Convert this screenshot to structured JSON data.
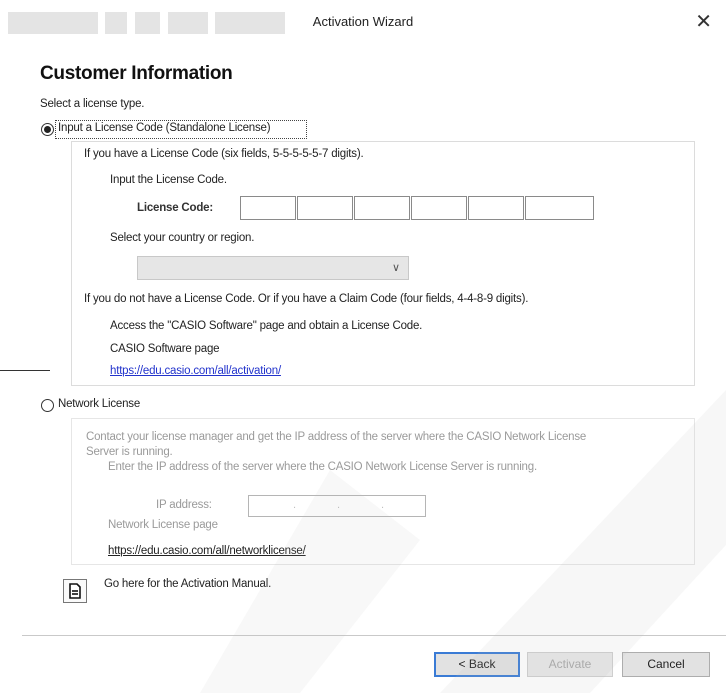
{
  "window": {
    "title": "Activation Wizard",
    "close_glyph": "✕"
  },
  "heading": "Customer Information",
  "select_license_type": "Select a license type.",
  "standalone": {
    "option_label": "Input a License Code (Standalone License)",
    "selected": true,
    "have_code_text": "If you have a License Code (six fields, 5-5-5-5-5-7 digits).",
    "input_code_text": "Input the License Code.",
    "code_label": "License Code:",
    "code_fields": [
      "",
      "",
      "",
      "",
      "",
      ""
    ],
    "country_text": "Select your country or region.",
    "country_value": "",
    "no_code_text": "If you do not have a License Code. Or if you have a Claim Code (four fields, 4-4-8-9 digits).",
    "access_text": "Access the \"CASIO Software\" page and obtain a License Code.",
    "software_page_label": "CASIO Software page",
    "software_page_link": "https://edu.casio.com/all/activation/"
  },
  "network": {
    "option_label": "Network License",
    "selected": false,
    "contact_text_line1": "Contact your license manager and get the IP address of the server where the CASIO Network License",
    "contact_text_line2": "Server is running.",
    "enter_ip_text": "Enter the IP address of the server where the CASIO Network License Server is running.",
    "ip_label": "IP address:",
    "ip_dots": [
      ".",
      ".",
      "."
    ],
    "page_label": "Network License page",
    "page_link": "https://edu.casio.com/all/networklicense/"
  },
  "manual": {
    "icon": "document-icon",
    "text": "Go here for the Activation Manual."
  },
  "buttons": {
    "back": "< Back",
    "activate": "Activate",
    "cancel": "Cancel"
  },
  "colors": {
    "link": "#2233cc",
    "default_button_border": "#3a7bd5",
    "disabled_text": "#a8a8a8"
  }
}
